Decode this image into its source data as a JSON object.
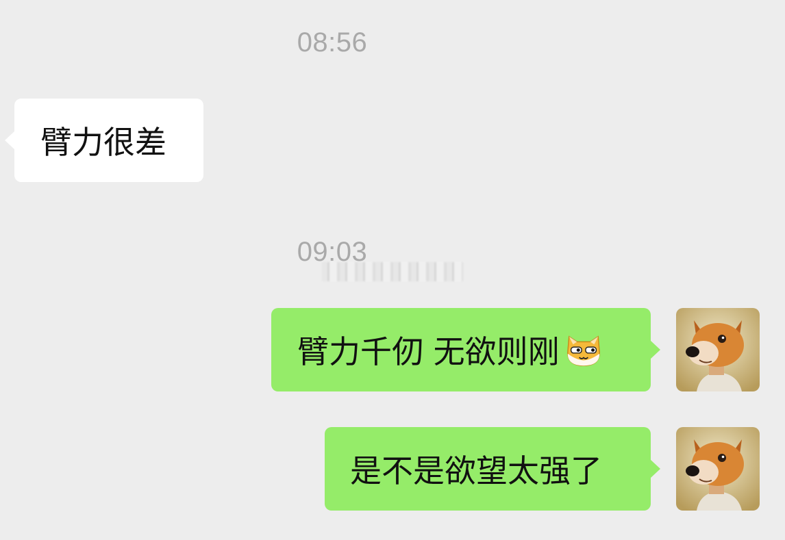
{
  "messages": [
    {
      "type": "timestamp",
      "text": "08:56"
    },
    {
      "type": "incoming",
      "text": "臂力很差"
    },
    {
      "type": "timestamp",
      "text": "09:03"
    },
    {
      "type": "outgoing",
      "text": "臂力千仞 无欲则刚",
      "emoji": "cat-face-emoji"
    },
    {
      "type": "outgoing",
      "text": "是不是欲望太强了"
    }
  ],
  "avatar": {
    "icon": "shiba-dog-avatar"
  },
  "colors": {
    "background": "#ededed",
    "incoming_bubble": "#ffffff",
    "outgoing_bubble": "#95ec69",
    "timestamp": "#a9a9a9"
  }
}
